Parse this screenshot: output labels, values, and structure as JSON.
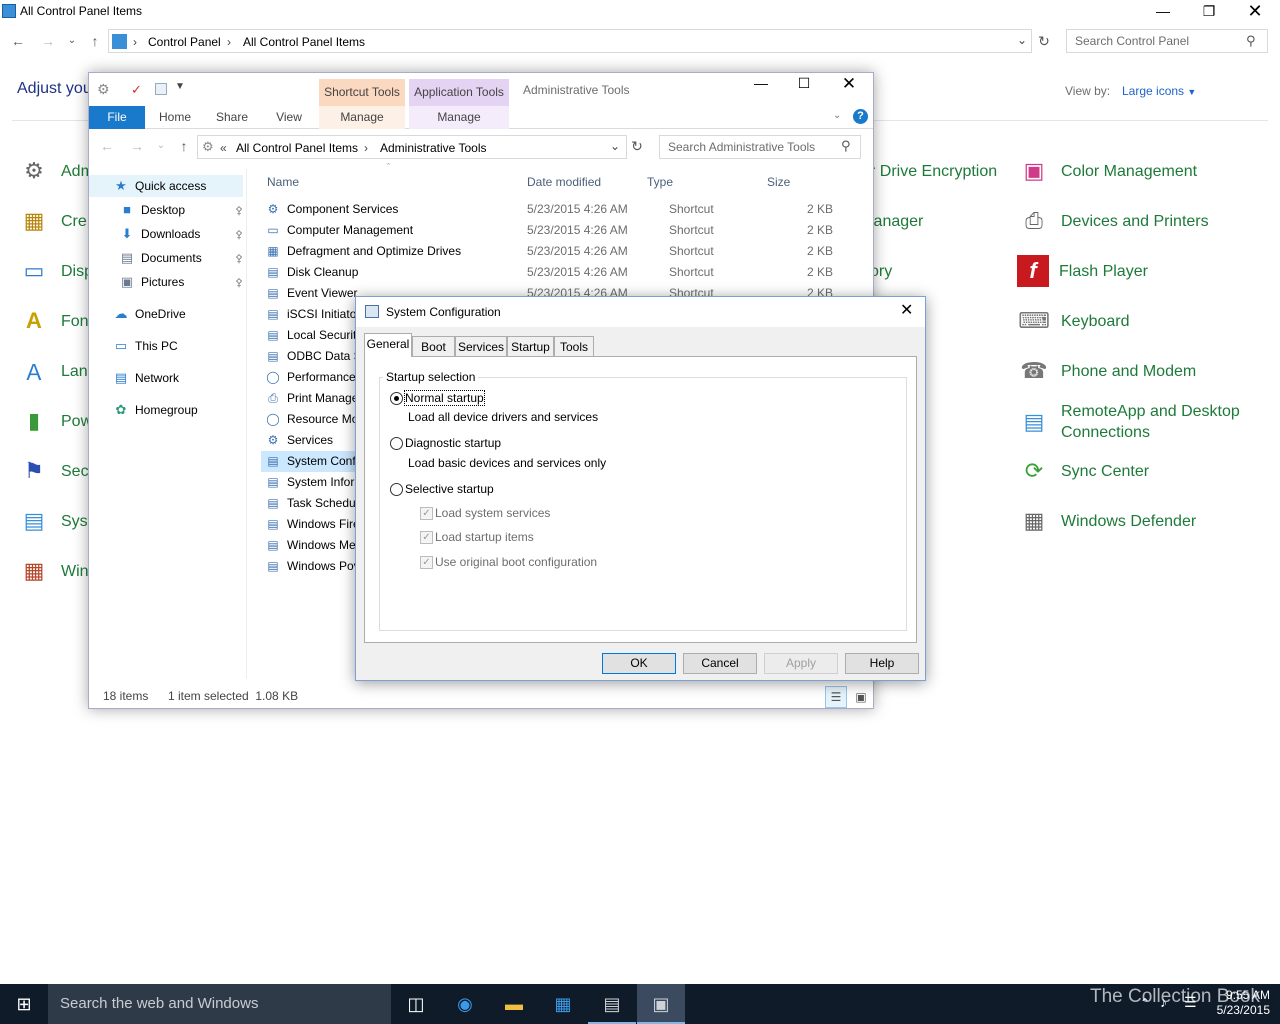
{
  "cp": {
    "title": "All Control Panel Items",
    "crumbs": [
      "Control Panel",
      "All Control Panel Items"
    ],
    "search_placeholder": "Search Control Panel",
    "heading": "Adjust you",
    "view_by_label": "View by:",
    "view_by_value": "Large icons",
    "left_items": [
      "Adm",
      "Cre",
      "Disp",
      "Fon",
      "Lan",
      "Pow",
      "Secu",
      "Syst",
      "Win"
    ],
    "mid_items": [
      "r Drive Encryption",
      "lanager",
      "ory"
    ],
    "right_items": [
      "Color Management",
      "Devices and Printers",
      "Flash Player",
      "Keyboard",
      "Phone and Modem",
      "RemoteApp and Desktop",
      "Connections",
      "Sync Center",
      "Windows Defender"
    ]
  },
  "explorer": {
    "title": "Administrative Tools",
    "ctx_shortcut": "Shortcut Tools",
    "ctx_app": "Application Tools",
    "tabs": [
      "File",
      "Home",
      "Share",
      "View",
      "Manage",
      "Manage"
    ],
    "crumbs": [
      "«",
      "All Control Panel Items",
      "Administrative Tools"
    ],
    "search_placeholder": "Search Administrative Tools",
    "nav": [
      "Quick access",
      "Desktop",
      "Downloads",
      "Documents",
      "Pictures",
      "OneDrive",
      "This PC",
      "Network",
      "Homegroup"
    ],
    "columns": [
      "Name",
      "Date modified",
      "Type",
      "Size"
    ],
    "files": [
      {
        "name": "Component Services",
        "date": "5/23/2015 4:26 AM",
        "type": "Shortcut",
        "size": "2 KB"
      },
      {
        "name": "Computer Management",
        "date": "5/23/2015 4:26 AM",
        "type": "Shortcut",
        "size": "2 KB"
      },
      {
        "name": "Defragment and Optimize Drives",
        "date": "5/23/2015 4:26 AM",
        "type": "Shortcut",
        "size": "2 KB"
      },
      {
        "name": "Disk Cleanup",
        "date": "5/23/2015 4:26 AM",
        "type": "Shortcut",
        "size": "2 KB"
      },
      {
        "name": "Event Viewer",
        "date": "5/23/2015 4:26 AM",
        "type": "Shortcut",
        "size": "2 KB"
      },
      {
        "name": "iSCSI Initiator",
        "date": "",
        "type": "",
        "size": ""
      },
      {
        "name": "Local Securit",
        "date": "",
        "type": "",
        "size": ""
      },
      {
        "name": "ODBC Data S",
        "date": "",
        "type": "",
        "size": ""
      },
      {
        "name": "Performance",
        "date": "",
        "type": "",
        "size": ""
      },
      {
        "name": "Print Manage",
        "date": "",
        "type": "",
        "size": ""
      },
      {
        "name": "Resource Mo",
        "date": "",
        "type": "",
        "size": ""
      },
      {
        "name": "Services",
        "date": "",
        "type": "",
        "size": ""
      },
      {
        "name": "System Conf",
        "date": "",
        "type": "",
        "size": ""
      },
      {
        "name": "System Infor",
        "date": "",
        "type": "",
        "size": ""
      },
      {
        "name": "Task Schedul",
        "date": "",
        "type": "",
        "size": ""
      },
      {
        "name": "Windows Fire",
        "date": "",
        "type": "",
        "size": ""
      },
      {
        "name": "Windows Me",
        "date": "",
        "type": "",
        "size": ""
      },
      {
        "name": "Windows Pov",
        "date": "",
        "type": "",
        "size": ""
      }
    ],
    "status_count": "18 items",
    "status_selected": "1 item selected  1.08 KB"
  },
  "msconfig": {
    "title": "System Configuration",
    "tabs": [
      "General",
      "Boot",
      "Services",
      "Startup",
      "Tools"
    ],
    "group_label": "Startup selection",
    "normal": "Normal startup",
    "normal_desc": "Load all device drivers and services",
    "diagnostic": "Diagnostic startup",
    "diagnostic_desc": "Load basic devices and services only",
    "selective": "Selective startup",
    "opt_services": "Load system services",
    "opt_startup": "Load startup items",
    "opt_boot": "Use original boot configuration",
    "buttons": [
      "OK",
      "Cancel",
      "Apply",
      "Help"
    ]
  },
  "taskbar": {
    "search": "Search the web and Windows",
    "time": "9:55 AM",
    "date": "5/23/2015",
    "watermark": "The Collection Book"
  },
  "colors": {
    "link_green": "#1e7a39",
    "accent_blue": "#1979ca",
    "taskbar": "#101b2a"
  }
}
